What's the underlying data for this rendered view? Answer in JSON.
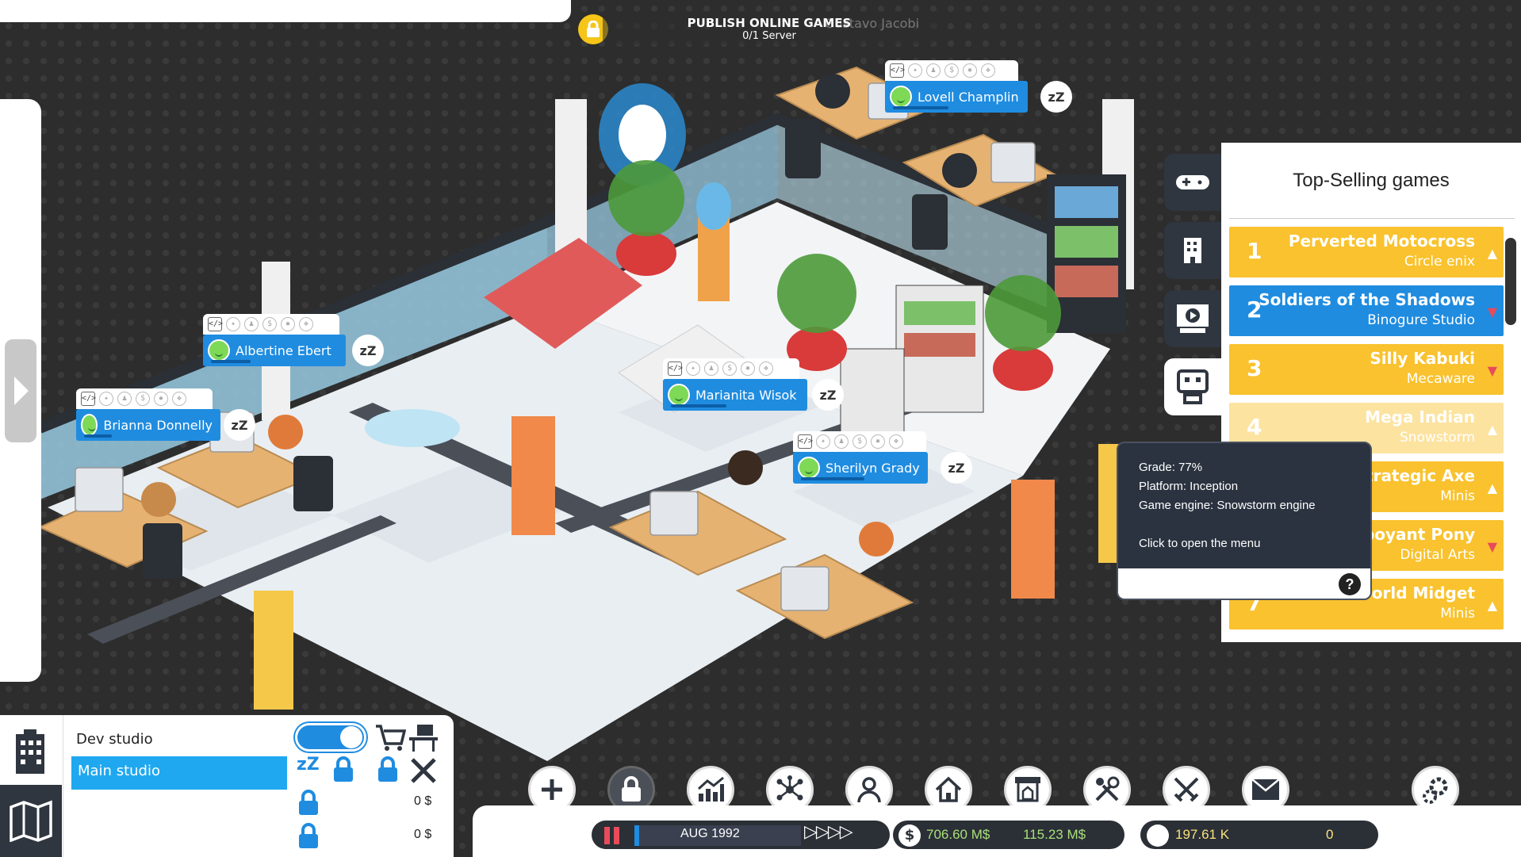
{
  "publish": {
    "title": "PUBLISH ONLINE GAMES",
    "sub": "0/1 Server",
    "behind_name": "Gustavo Jacobi"
  },
  "employees": [
    {
      "name": "Lovell Champlin"
    },
    {
      "name": "Albertine Ebert"
    },
    {
      "name": "Brianna Donnelly"
    },
    {
      "name": "Marianita Wisok"
    },
    {
      "name": "Sherilyn Grady"
    }
  ],
  "sleep_label": "zZ",
  "top_selling": {
    "title": "Top-Selling games",
    "games": [
      {
        "rank": "1",
        "title": "Perverted Motocross",
        "studio": "Circle enix",
        "trend": "up"
      },
      {
        "rank": "2",
        "title": "Soldiers of the Shadows",
        "studio": "Binogure Studio",
        "trend": "down"
      },
      {
        "rank": "3",
        "title": "Silly Kabuki",
        "studio": "Mecaware",
        "trend": "down"
      },
      {
        "rank": "4",
        "title": "Mega Indian",
        "studio": "Snowstorm",
        "trend": "up"
      },
      {
        "rank": "5",
        "title": "Strategic Axe",
        "studio": "Minis",
        "trend": "up"
      },
      {
        "rank": "6",
        "title": "Flamboyant Pony",
        "studio": "Digital Arts",
        "trend": "down"
      },
      {
        "rank": "7",
        "title": "Third-World Midget",
        "studio": "Minis",
        "trend": "up"
      }
    ]
  },
  "tooltip": {
    "grade": "Grade: 77%",
    "platform": "Platform: Inception",
    "engine": "Game engine: Snowstorm engine",
    "hint": "Click to open the menu",
    "help": "?"
  },
  "studio_panel": {
    "dev_label": "Dev studio",
    "main_label": "Main studio",
    "money_1": "0 $",
    "money_2": "0 $"
  },
  "status_bar": {
    "date": "AUG  1992",
    "speed": "▷▷▷▷",
    "cash": "706.60 M$",
    "income": "115.23 M$",
    "fans": "197.61 K",
    "fans_delta": "0",
    "cash_icon": "$"
  },
  "colors": {
    "accent_blue": "#1f8ce0",
    "game_yellow": "#f9c22e",
    "panel_dark": "#2f3640",
    "cash_green": "#a8e07a",
    "pause_red": "#e84b5a"
  }
}
